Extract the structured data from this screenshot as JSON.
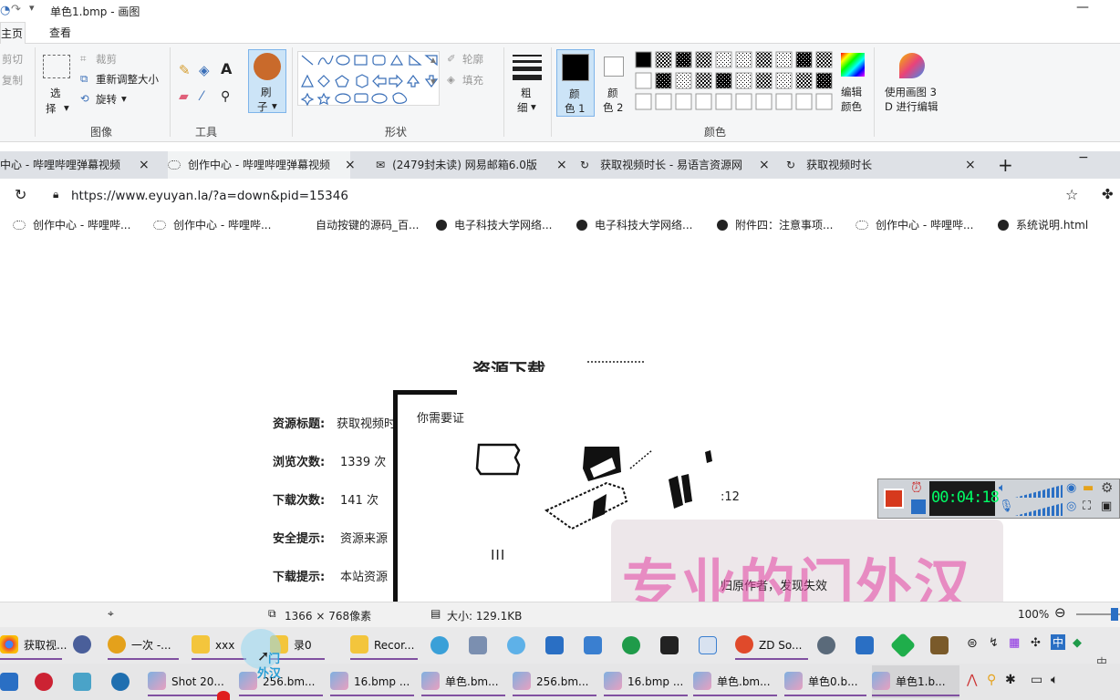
{
  "paint": {
    "window_title": "单色1.bmp - 画图",
    "tabs": [
      "主页",
      "查看"
    ],
    "clipboard": {
      "cut": "剪切",
      "copy": "复制"
    },
    "image_group": {
      "select": "选",
      "select2": "择",
      "crop": "裁剪",
      "resize": "重新调整大小",
      "rotate": "旋转",
      "label": "图像"
    },
    "tools_label": "工具",
    "brush": {
      "line1": "刷",
      "line2": "子"
    },
    "shapes": {
      "outline": "轮廓",
      "fill": "填充",
      "label": "形状"
    },
    "size": {
      "line1": "粗",
      "line2": "细"
    },
    "color1": {
      "line1": "颜",
      "line2": "色 1"
    },
    "color2": {
      "line1": "颜",
      "line2": "色 2"
    },
    "edit_colors": {
      "line1": "编辑",
      "line2": "颜色"
    },
    "colors_label": "颜色",
    "paint3d": {
      "line1": "使用画图 3",
      "line2": "D 进行编辑"
    },
    "status": {
      "dimensions": "1366 × 768像素",
      "size": "大小: 129.1KB",
      "zoom": "100%"
    }
  },
  "browser": {
    "tabs": [
      {
        "title": "中心 - 哔哩哔哩弹幕视频",
        "close": "×"
      },
      {
        "title": "创作中心 - 哔哩哔哩弹幕视频",
        "close": "×"
      },
      {
        "title": "(2479封未读) 网易邮箱6.0版",
        "close": "×"
      },
      {
        "title": "获取视频时长 - 易语言资源网",
        "close": "×"
      },
      {
        "title": "获取视频时长",
        "close": "×"
      }
    ],
    "new_tab": "+",
    "minimize": "−",
    "url": "https://www.eyuyan.la/?a=down&pid=15346",
    "bookmarks": [
      "创作中心 - 哔哩哔...",
      "创作中心 - 哔哩哔...",
      "自动按键的源码_百...",
      "电子科技大学网络...",
      "电子科技大学网络...",
      "附件四：注意事项...",
      "创作中心 - 哔哩哔...",
      "系统说明.html"
    ]
  },
  "page": {
    "heading": "资源下载",
    "rows": [
      {
        "label": "资源标题:",
        "value": "获取视频时"
      },
      {
        "label": "浏览次数:",
        "value": "1339 次"
      },
      {
        "label": "下载次数:",
        "value": "141 次"
      },
      {
        "label": "安全提示:",
        "value": "资源来源"
      },
      {
        "label": "下载提示:",
        "value": "本站资源"
      }
    ],
    "dialog_text": "你需要证",
    "time_fragment": ":12",
    "pause_glyph": "III",
    "right_fragment": "归原作者，发现失效"
  },
  "watermark": "专业的门外汉",
  "cursor_watermark": {
    "line1": "门",
    "line2": "外汉"
  },
  "recorder": {
    "timer": "00:04:18"
  },
  "taskbar_top": [
    "获取视...",
    "一次 -...",
    "xxx",
    "录0",
    "Recor...",
    "ZD So..."
  ],
  "taskbar_bottom": [
    "Shot 20...",
    "256.bm...",
    "16.bmp ...",
    "单色.bm...",
    "256.bm...",
    "16.bmp ...",
    "单色.bm...",
    "单色0.b...",
    "单色1.b..."
  ],
  "tray": {
    "ime": "中",
    "clock": "中"
  },
  "colors": {
    "selected_blue": "#cce4f7",
    "recorder_bg": "#1a1a1a",
    "timer_fg": "#00ff66",
    "watermark": "#e23fa0",
    "underline": "#8050a0"
  }
}
